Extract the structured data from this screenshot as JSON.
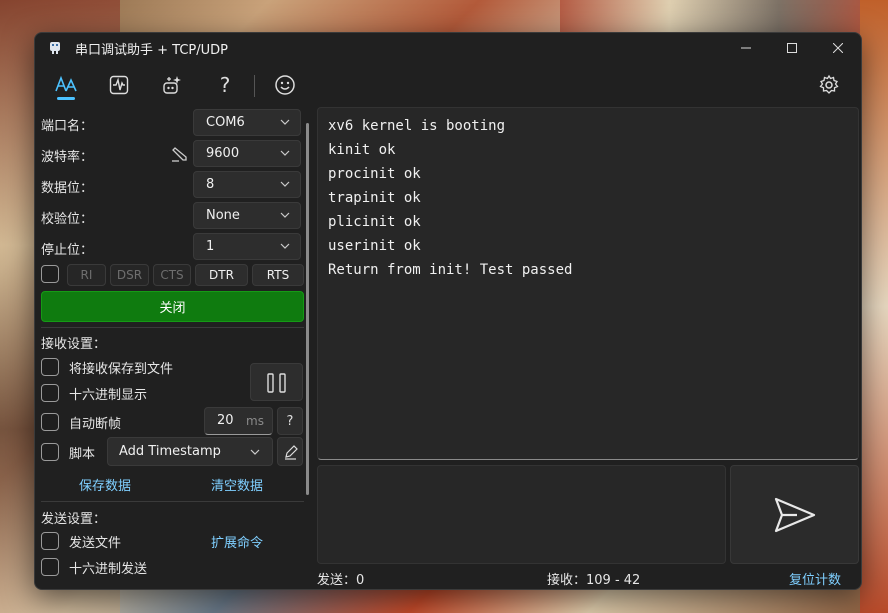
{
  "window": {
    "title": "串口调试助手 + TCP/UDP"
  },
  "toolbar": {
    "tabs": [
      {
        "icon": "font-icon"
      },
      {
        "icon": "waveform-icon"
      },
      {
        "icon": "sparkle-icon"
      },
      {
        "icon": "help-icon",
        "glyph": "?"
      },
      {
        "icon": "smiley-icon"
      }
    ],
    "settings_icon": "gear-icon"
  },
  "serial": {
    "port_label": "端口名：",
    "port_value": "COM6",
    "baud_label": "波特率：",
    "baud_value": "9600",
    "databits_label": "数据位：",
    "databits_value": "8",
    "parity_label": "校验位：",
    "parity_value": "None",
    "stopbits_label": "停止位：",
    "stopbits_value": "1",
    "signals": [
      "RI",
      "DSR",
      "CTS",
      "DTR",
      "RTS"
    ],
    "close_label": "关闭"
  },
  "receive_settings": {
    "title": "接收设置：",
    "save_to_file": "将接收保存到文件",
    "hex_display": "十六进制显示",
    "auto_frame": "自动断帧",
    "frame_value": "20",
    "frame_unit": "ms",
    "help": "?",
    "script": "脚本",
    "script_value": "Add Timestamp",
    "save_data": "保存数据",
    "clear_data": "清空数据"
  },
  "send_settings": {
    "title": "发送设置：",
    "send_file": "发送文件",
    "ext_cmd": "扩展命令",
    "hex_send": "十六进制发送"
  },
  "receive_output": [
    "xv6 kernel is booting",
    "kinit ok",
    "procinit ok",
    "trapinit ok",
    "plicinit ok",
    "userinit ok",
    "Return from init! Test passed"
  ],
  "status": {
    "sent": "发送：0",
    "received": "接收：109 - 42",
    "reset": "复位计数"
  },
  "colors": {
    "accent": "#4cc2ff",
    "close_button": "#0f7b0f",
    "link": "#7fcfff"
  }
}
